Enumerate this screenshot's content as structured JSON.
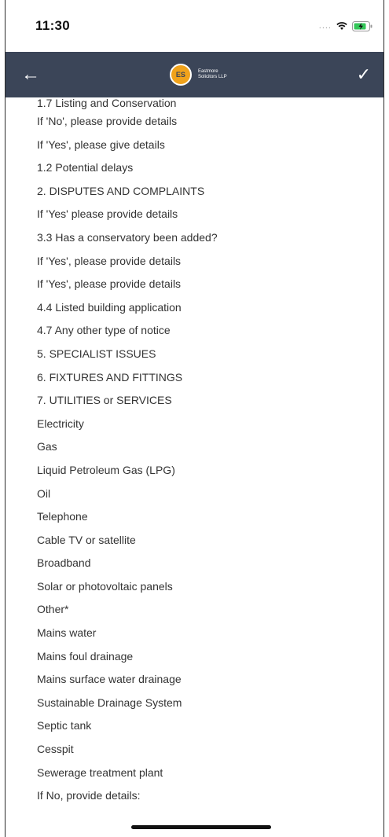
{
  "status_bar": {
    "time": "11:30",
    "signal": "....",
    "icons": [
      "wifi-icon",
      "battery-charging-icon"
    ]
  },
  "navbar": {
    "back_icon": "arrow-left-icon",
    "logo_initials": "ES",
    "logo_line1": "Eastmore",
    "logo_line2": "Solicitors LLP",
    "confirm_icon": "checkmark-icon"
  },
  "items": [
    "1.7   Listing and Conservation",
    "If 'No', please provide details",
    "If 'Yes', please give details",
    "1.2 Potential delays",
    "2. DISPUTES AND COMPLAINTS",
    "If 'Yes' please provide details",
    "3.3 Has a conservatory been added?",
    "If 'Yes', please provide details",
    "If 'Yes', please provide details",
    "4.4 Listed building application",
    "4.7 Any other type of notice",
    "5. SPECIALIST ISSUES",
    "6. FIXTURES AND FITTINGS",
    "7. UTILITIES or SERVICES",
    "Electricity",
    "Gas",
    "Liquid Petroleum Gas (LPG)",
    "Oil",
    "Telephone",
    "Cable TV or satellite",
    "Broadband",
    "Solar or photovoltaic panels",
    "Other*",
    "Mains water",
    "Mains foul drainage",
    "Mains surface water drainage",
    "Sustainable Drainage System",
    "Septic tank",
    "Cesspit",
    "Sewerage treatment plant",
    "If No, provide details:"
  ],
  "colors": {
    "navbar": "#3b4558",
    "logo": "#f0a21b"
  }
}
